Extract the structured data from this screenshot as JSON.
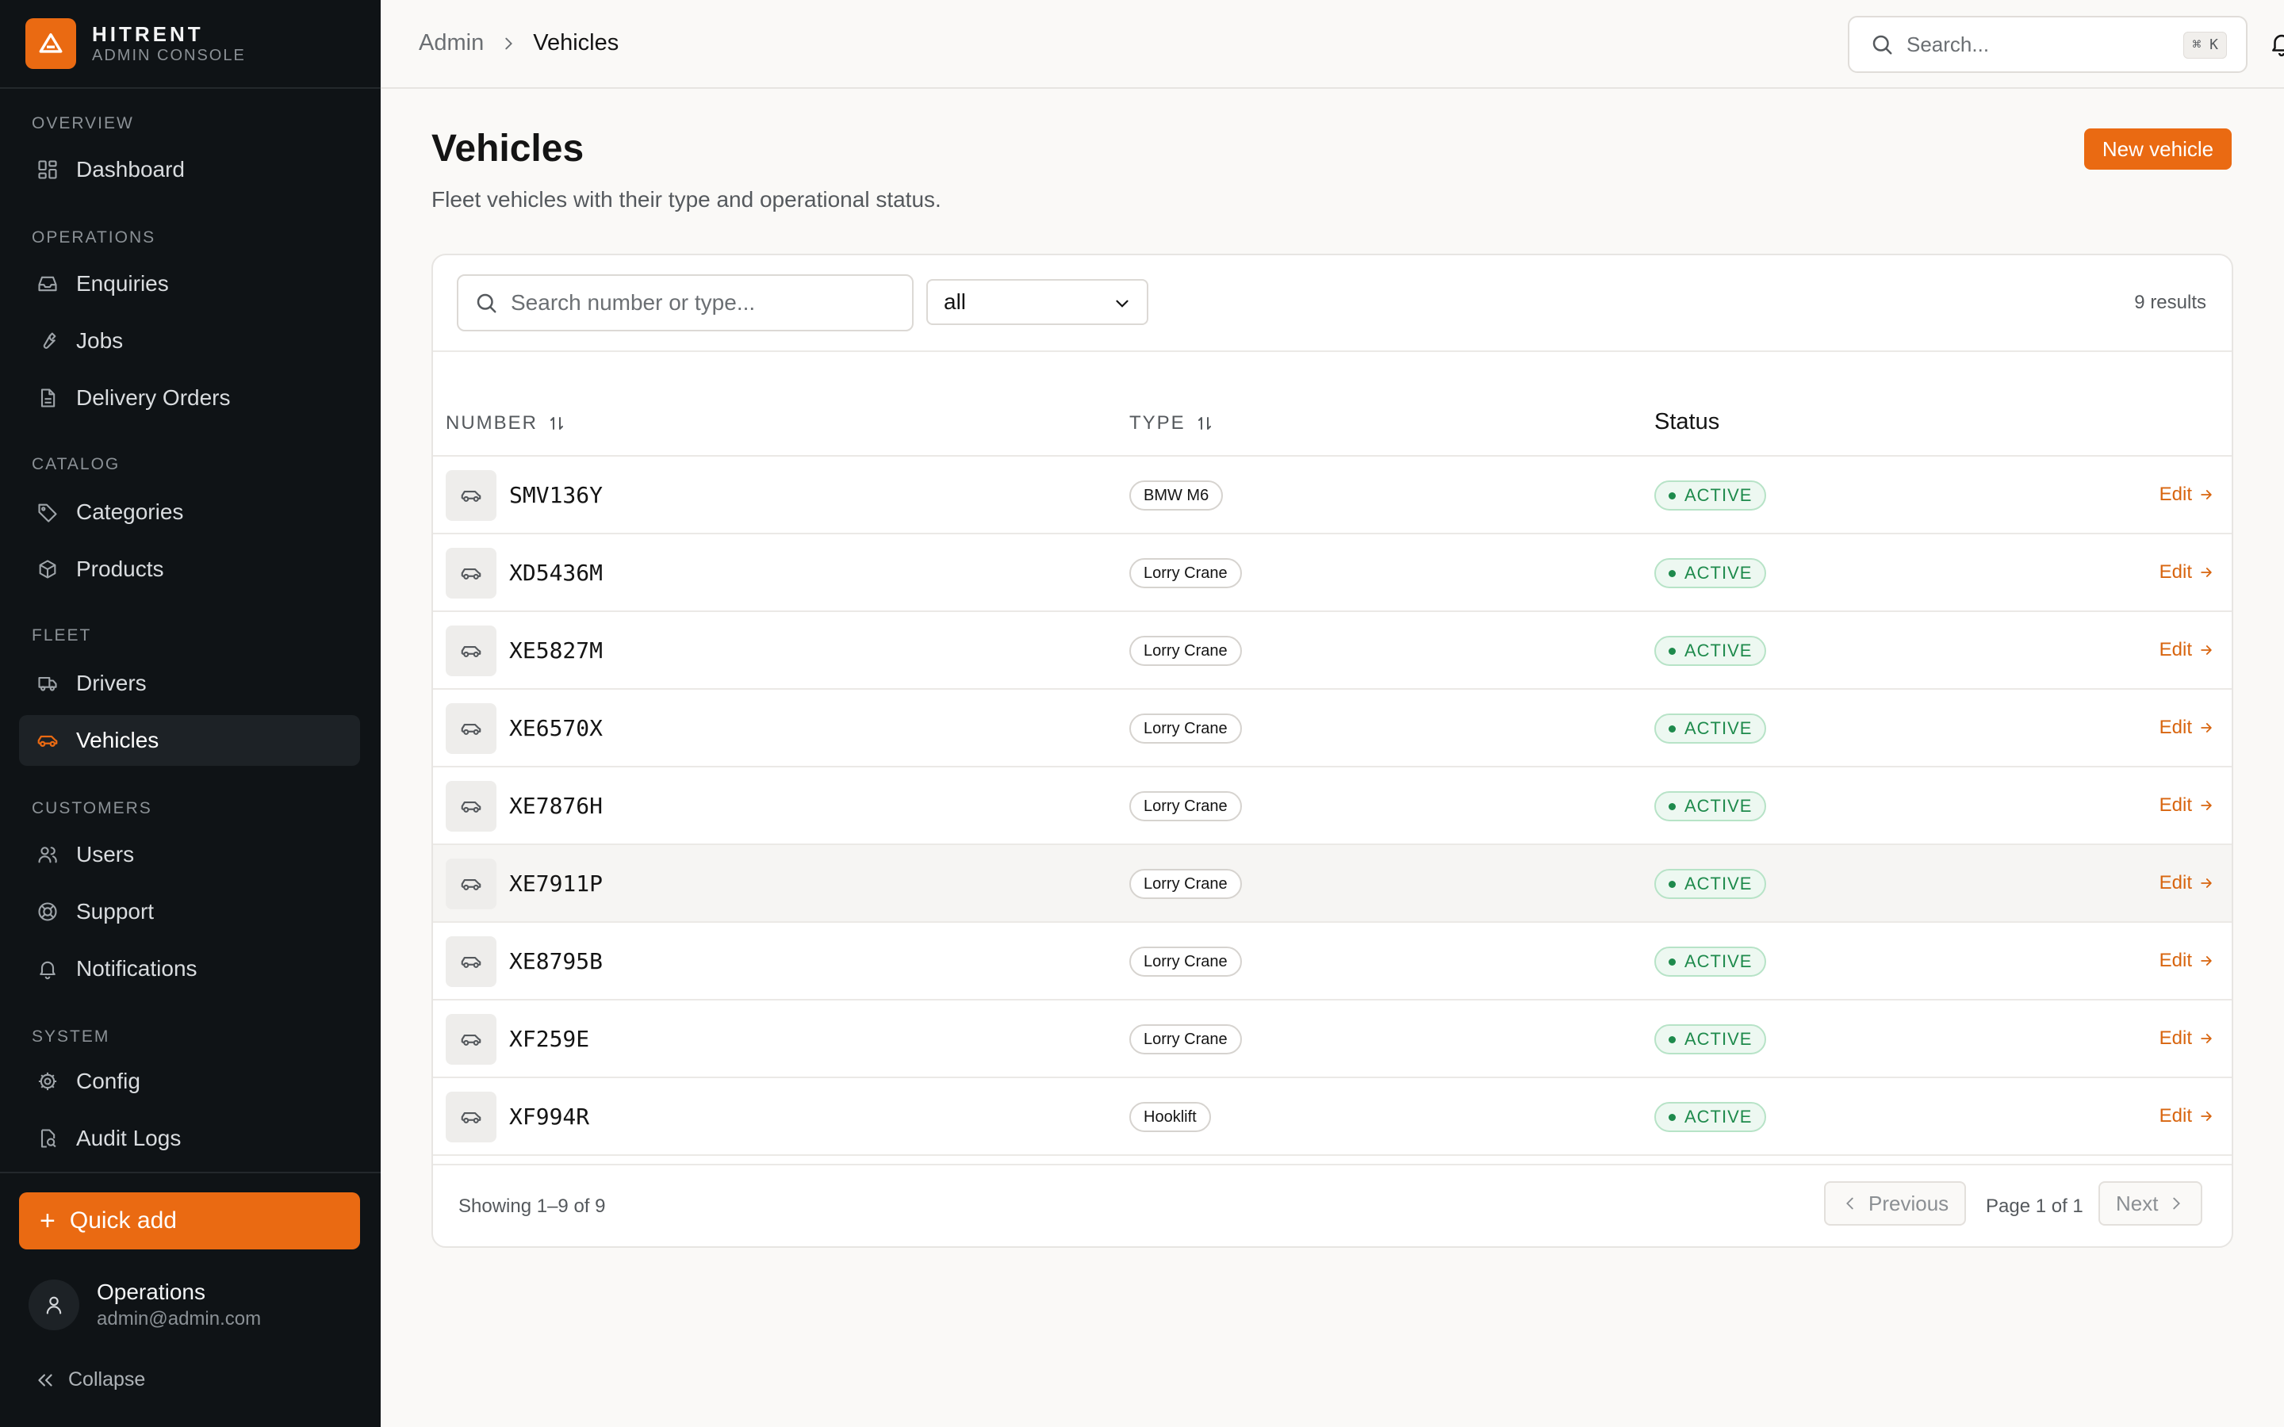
{
  "brand": {
    "name": "HITRENT",
    "subtitle": "ADMIN CONSOLE",
    "accent": "#ea6a12"
  },
  "sidebar": {
    "sections": [
      {
        "label": "OVERVIEW"
      },
      {
        "label": "OPERATIONS"
      },
      {
        "label": "CATALOG"
      },
      {
        "label": "FLEET"
      },
      {
        "label": "CUSTOMERS"
      },
      {
        "label": "SYSTEM"
      }
    ],
    "items": [
      {
        "label": "Dashboard",
        "icon": "dashboard-icon"
      },
      {
        "label": "Enquiries",
        "icon": "inbox-icon"
      },
      {
        "label": "Jobs",
        "icon": "wrench-icon"
      },
      {
        "label": "Delivery Orders",
        "icon": "document-icon"
      },
      {
        "label": "Categories",
        "icon": "tag-icon"
      },
      {
        "label": "Products",
        "icon": "box-icon"
      },
      {
        "label": "Drivers",
        "icon": "truck-icon"
      },
      {
        "label": "Vehicles",
        "icon": "car-icon",
        "active": true
      },
      {
        "label": "Users",
        "icon": "users-icon"
      },
      {
        "label": "Support",
        "icon": "lifebuoy-icon"
      },
      {
        "label": "Notifications",
        "icon": "bell-icon"
      },
      {
        "label": "Config",
        "icon": "gear-icon"
      },
      {
        "label": "Audit Logs",
        "icon": "audit-icon"
      }
    ],
    "quick_add": "Quick add",
    "user": {
      "name": "Operations",
      "email": "admin@admin.com"
    },
    "collapse": "Collapse"
  },
  "topbar": {
    "breadcrumb": {
      "root": "Admin",
      "current": "Vehicles"
    },
    "search_placeholder": "Search...",
    "shortcut": "⌘ K"
  },
  "page": {
    "title": "Vehicles",
    "subtitle": "Fleet vehicles with their type and operational status.",
    "new_button": "New vehicle"
  },
  "filters": {
    "search_placeholder": "Search number or type...",
    "type_value": "all",
    "results": "9 results"
  },
  "table": {
    "columns": {
      "number": "NUMBER",
      "type": "TYPE",
      "status": "Status"
    },
    "edit_label": "Edit",
    "rows": [
      {
        "number": "SMV136Y",
        "type": "BMW M6",
        "status": "ACTIVE"
      },
      {
        "number": "XD5436M",
        "type": "Lorry Crane",
        "status": "ACTIVE"
      },
      {
        "number": "XE5827M",
        "type": "Lorry Crane",
        "status": "ACTIVE"
      },
      {
        "number": "XE6570X",
        "type": "Lorry Crane",
        "status": "ACTIVE"
      },
      {
        "number": "XE7876H",
        "type": "Lorry Crane",
        "status": "ACTIVE"
      },
      {
        "number": "XE7911P",
        "type": "Lorry Crane",
        "status": "ACTIVE"
      },
      {
        "number": "XE8795B",
        "type": "Lorry Crane",
        "status": "ACTIVE"
      },
      {
        "number": "XF259E",
        "type": "Lorry Crane",
        "status": "ACTIVE"
      },
      {
        "number": "XF994R",
        "type": "Hooklift",
        "status": "ACTIVE"
      }
    ]
  },
  "pagination": {
    "showing": "Showing 1–9 of 9",
    "previous": "Previous",
    "page": "Page 1 of 1",
    "next": "Next"
  }
}
